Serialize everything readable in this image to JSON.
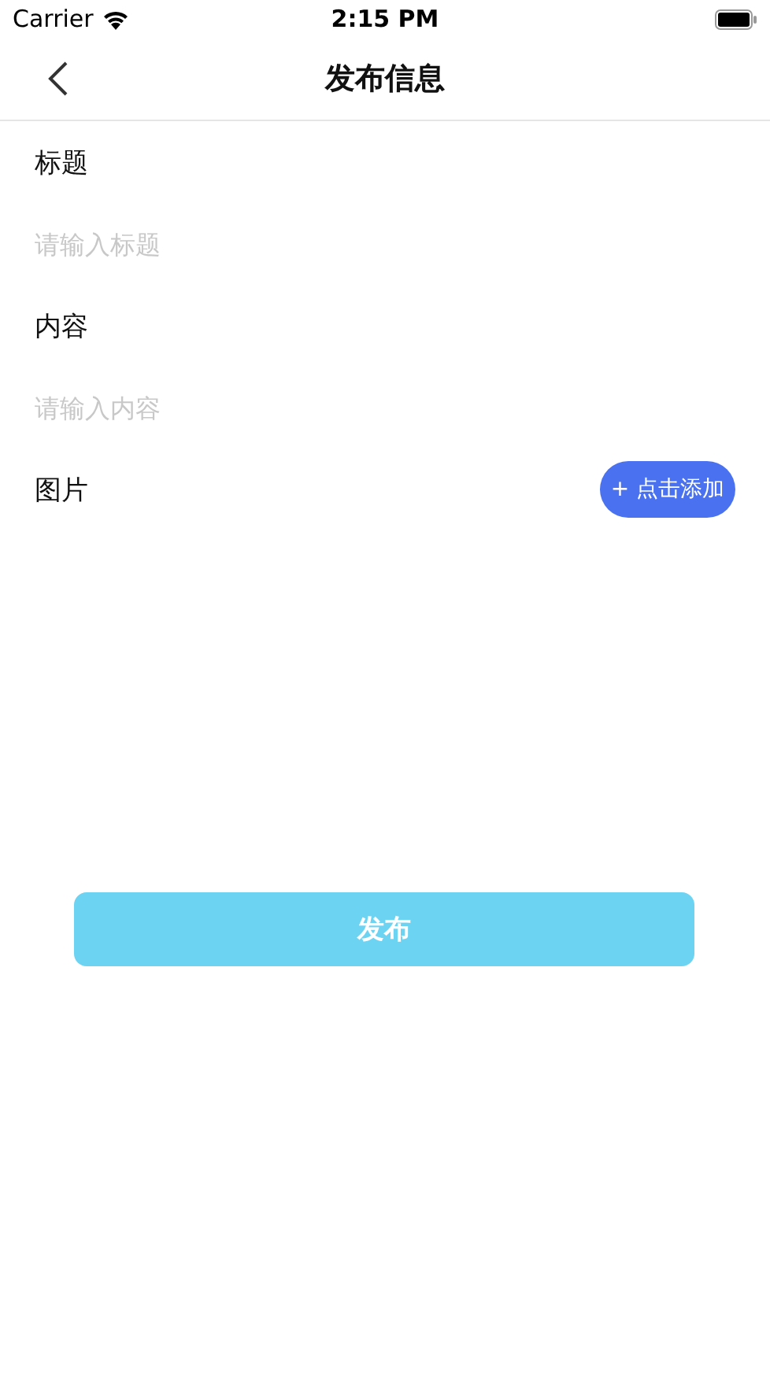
{
  "status_bar": {
    "carrier": "Carrier",
    "time": "2:15 PM"
  },
  "nav": {
    "title": "发布信息"
  },
  "fields": [
    {
      "label": "标题",
      "placeholder": "请输入标题"
    },
    {
      "label": "内容",
      "placeholder": "请输入内容"
    }
  ],
  "images": {
    "label": "图片",
    "add_button": "+ 点击添加"
  },
  "submit": "发布"
}
